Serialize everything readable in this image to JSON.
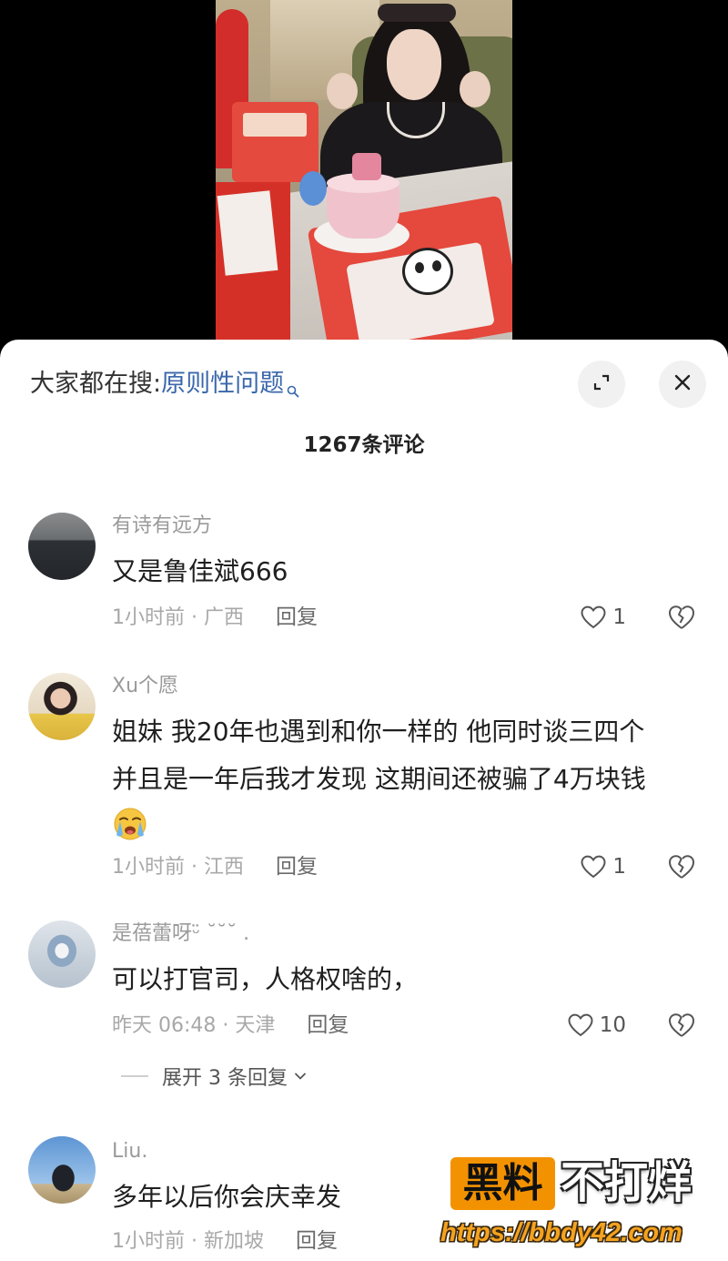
{
  "search_bar": {
    "prefix": "大家都在搜:",
    "term": "原则性问题"
  },
  "comment_count": "1267条评论",
  "comments": [
    {
      "username": "有诗有远方",
      "lines": [
        "又是鲁佳斌666"
      ],
      "meta": "1小时前 · 广西",
      "reply_label": "回复",
      "likes": "1"
    },
    {
      "username": "Xu个愿",
      "lines": [
        "姐妹 我20年也遇到和你一样的 他同时谈三四个",
        "并且是一年后我才发现 这期间还被骗了4万块钱"
      ],
      "emoji": "crying-face-emoji",
      "meta": "1小时前 · 江西",
      "reply_label": "回复",
      "likes": "1"
    },
    {
      "username": "是蓓蕾呀ᵕ̈ ˘˘˘ .",
      "lines": [
        "可以打官司，人格权啥的，"
      ],
      "meta": "昨天 06:48 · 天津",
      "reply_label": "回复",
      "likes": "10"
    },
    {
      "username": "Liu.",
      "lines": [
        "多年以后你会庆幸发"
      ],
      "meta": "1小时前 · 新加坡",
      "reply_label": "回复"
    }
  ],
  "expand_replies": {
    "label": "展开 3 条回复"
  },
  "watermark": {
    "badge": "黑料",
    "text": "不打烊",
    "url": "https://bbdy42.com"
  },
  "icons": {
    "search": "search-icon",
    "expand": "expand-icon",
    "close": "close-icon",
    "like": "heart-icon",
    "dislike": "broken-heart-icon",
    "expand_chevron": "chevron-down-icon"
  },
  "colors": {
    "accent": "#3b67ab",
    "watermark_orange": "#f39200",
    "background_video": "#000000",
    "sheet": "#ffffff"
  }
}
